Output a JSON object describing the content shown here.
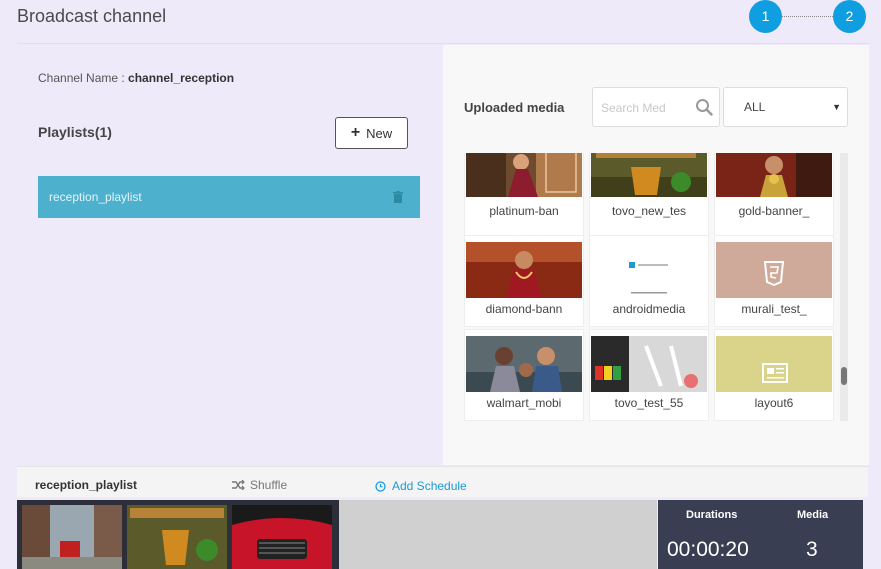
{
  "header": {
    "title": "Broadcast channel",
    "steps": [
      "1",
      "2"
    ],
    "accent_color": "#0f9ee0"
  },
  "left": {
    "channel_label": "Channel Name : ",
    "channel_name": "channel_reception",
    "playlists_title": "Playlists(1)",
    "new_button": "New",
    "playlists": [
      {
        "name": "reception_playlist"
      }
    ],
    "selected_color": "#4db0cc"
  },
  "right": {
    "uploaded_label": "Uploaded media",
    "search_placeholder": "Search Med",
    "filter_value": "ALL",
    "media": [
      {
        "label": "platinum-ban",
        "icon": "saree-photo"
      },
      {
        "label": "tovo_new_tes",
        "icon": "infusion-century-photo"
      },
      {
        "label": "gold-banner_",
        "icon": "jewelry-photo"
      },
      {
        "label": "diamond-bann",
        "icon": "necklace-photo"
      },
      {
        "label": "androidmedia",
        "icon": "document-thumbnail"
      },
      {
        "label": "murali_test_",
        "icon": "html5-icon"
      },
      {
        "label": "walmart_mobi",
        "icon": "family-photo"
      },
      {
        "label": "tovo_test_55",
        "icon": "holi-drinks-photo"
      },
      {
        "label": "layout6",
        "icon": "layout-icon"
      }
    ]
  },
  "bottom": {
    "playlist_name": "reception_playlist",
    "shuffle_label": "Shuffle",
    "add_schedule_label": "Add Schedule",
    "durations_label": "Durations",
    "durations_value": "00:00:20",
    "media_label": "Media",
    "media_value": "3",
    "timeline_thumbs": [
      "street-photo",
      "infusion-century-photo",
      "red-car-photo"
    ]
  }
}
